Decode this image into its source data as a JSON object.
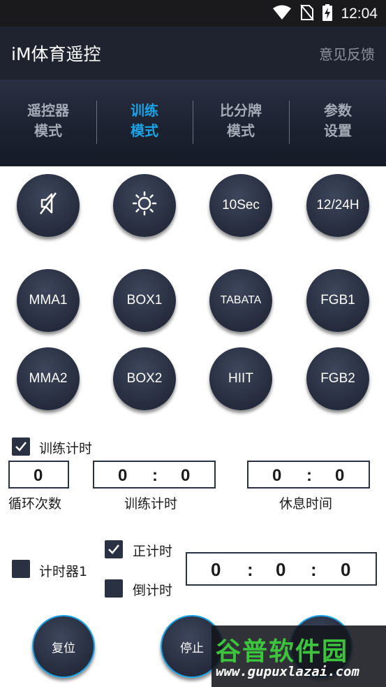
{
  "status_bar": {
    "time": "12:04",
    "icons": [
      "wifi-icon",
      "no-sim-icon",
      "battery-charging-icon"
    ]
  },
  "app": {
    "title": "iM体育遥控",
    "feedback": "意见反馈"
  },
  "tabs": [
    {
      "line1": "遥控器",
      "line2": "模式",
      "active": false
    },
    {
      "line1": "训练",
      "line2": "模式",
      "active": true
    },
    {
      "line1": "比分牌",
      "line2": "模式",
      "active": false
    },
    {
      "line1": "参数",
      "line2": "设置",
      "active": false
    }
  ],
  "row1": {
    "mute_icon": "mute-icon",
    "brightness_icon": "brightness-icon",
    "sec": "10Sec",
    "hour": "12/24H"
  },
  "row2": {
    "b1": "MMA1",
    "b2": "BOX1",
    "b3": "TABATA",
    "b4": "FGB1"
  },
  "row3": {
    "b1": "MMA2",
    "b2": "BOX2",
    "b3": "HIIT",
    "b4": "FGB2"
  },
  "training": {
    "checkbox_label": "训练计时",
    "checked": true,
    "cycles": "0",
    "train_min": "0",
    "train_sec": "0",
    "rest_min": "0",
    "rest_sec": "0",
    "colon": ":",
    "cycles_label": "循环次数",
    "train_label": "训练计时",
    "rest_label": "休息时间"
  },
  "timer": {
    "label": "计时器1",
    "count_up_label": "正计时",
    "count_down_label": "倒计时",
    "count_up_checked": true,
    "count_down_checked": false,
    "h": "0",
    "m": "0",
    "s": "0",
    "colon": ":"
  },
  "bottom": {
    "reset": "复位",
    "stop": "停止"
  },
  "watermark": {
    "cn": "谷普软件园",
    "url": "www.gupuxlazai.com"
  },
  "colors": {
    "accent": "#1aa3e6",
    "button": "#2a3143",
    "appbar": "#1f2330"
  }
}
